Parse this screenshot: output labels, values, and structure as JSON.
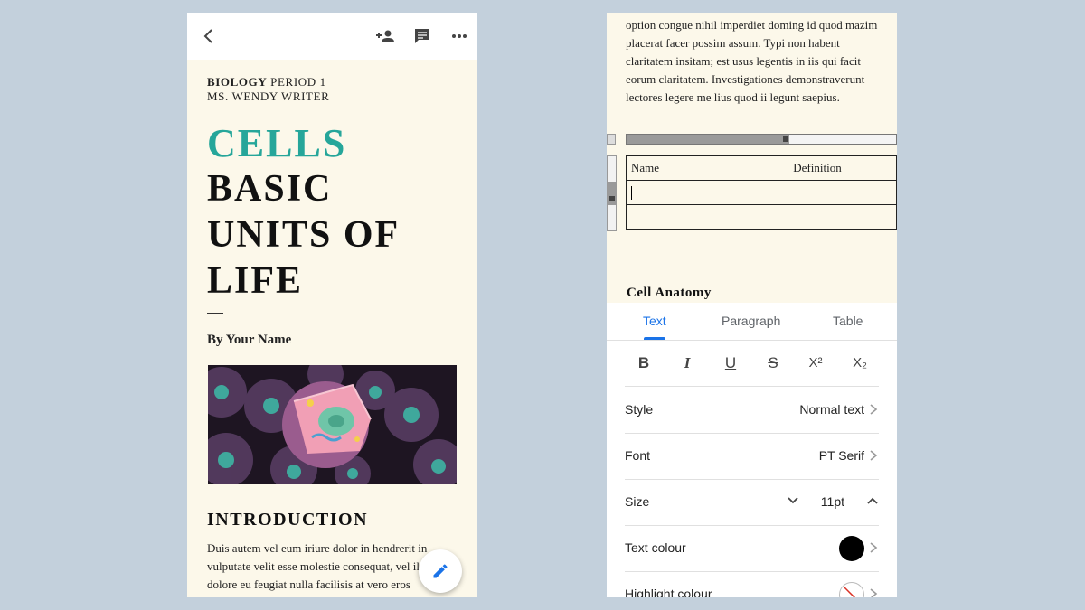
{
  "left": {
    "course_bold": "BIOLOGY",
    "course_rest": " PERIOD 1",
    "teacher": "MS. WENDY WRITER",
    "title_highlight": "CELLS",
    "title_lines": [
      "BASIC",
      "UNITS OF",
      "LIFE"
    ],
    "byline": "By Your Name",
    "section_heading": "INTRODUCTION",
    "body_text": "Duis autem vel eum iriure dolor in hendrerit in vulputate velit esse molestie consequat, vel illum dolore eu feugiat nulla facilisis at vero eros"
  },
  "right": {
    "body_text": "option congue nihil imperdiet doming id quod mazim placerat facer possim assum. Typi non habent claritatem insitam; est usus legentis in iis qui facit eorum claritatem. Investigationes demonstraverunt lectores legere me lius quod ii legunt saepius.",
    "table": {
      "headers": [
        "Name",
        "Definition"
      ],
      "rows": [
        [
          "",
          ""
        ],
        [
          "",
          ""
        ]
      ]
    },
    "subheading": "Cell Anatomy",
    "tabs": [
      {
        "label": "Text",
        "active": true
      },
      {
        "label": "Paragraph",
        "active": false
      },
      {
        "label": "Table",
        "active": false
      }
    ],
    "format_buttons": [
      "B",
      "I",
      "U",
      "S",
      "X²",
      "X₂"
    ],
    "style": {
      "label": "Style",
      "value": "Normal text"
    },
    "font": {
      "label": "Font",
      "value": "PT Serif"
    },
    "size": {
      "label": "Size",
      "value": "11pt"
    },
    "text_colour": {
      "label": "Text colour",
      "color": "#000000"
    },
    "highlight_colour": {
      "label": "Highlight colour"
    }
  },
  "colors": {
    "accent": "#1a73e8",
    "title_teal": "#26a69a",
    "page_bg": "#fcf8ea",
    "backdrop": "#c3d0dc"
  },
  "icons": [
    "back-arrow-icon",
    "add-person-icon",
    "comment-icon",
    "more-horizontal-icon",
    "edit-pencil-icon",
    "chevron-right-icon",
    "chevron-down-icon",
    "chevron-up-icon"
  ]
}
